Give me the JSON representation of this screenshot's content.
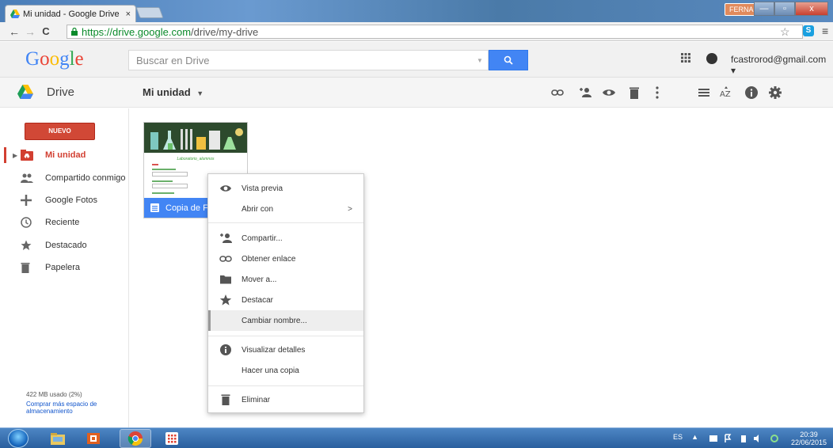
{
  "browser": {
    "tab_title": "Mi unidad - Google Drive",
    "tab_close": "×",
    "user_chip": "FERNANDO",
    "win_minimize": "—",
    "win_maximize": "▫",
    "win_close": "x",
    "url_host": "https://drive.google.com",
    "url_path": "/drive/my-drive",
    "nav_back": "←",
    "nav_forward": "→",
    "nav_reload": "C",
    "bookmark_star": "☆",
    "ext_label": "S",
    "menu": "≡"
  },
  "google": {
    "search_placeholder": "Buscar en Drive",
    "account": "fcastrorod@gmail.com ▾",
    "logo_colors": [
      "#4285f4",
      "#ea4335",
      "#fbbc05",
      "#4285f4",
      "#34a853",
      "#ea4335"
    ]
  },
  "drive": {
    "app_name": "Drive",
    "location": "Mi unidad",
    "location_caret": "▼"
  },
  "sidebar": {
    "new_label": "NUEVO",
    "items": [
      {
        "label": "Mi unidad",
        "icon": "my-drive-icon"
      },
      {
        "label": "Compartido conmigo",
        "icon": "shared-icon"
      },
      {
        "label": "Google Fotos",
        "icon": "photos-icon"
      },
      {
        "label": "Reciente",
        "icon": "clock-icon"
      },
      {
        "label": "Destacado",
        "icon": "star-icon"
      },
      {
        "label": "Papelera",
        "icon": "trash-icon"
      }
    ],
    "expand_arrow": "▶",
    "quota": "422 MB usado (2%)",
    "quota_link": "Comprar más espacio de almacenamiento"
  },
  "file": {
    "name": "Copia de Formulario",
    "thumb_title": "Laboratorio_alumnos"
  },
  "context_menu": {
    "items": [
      {
        "label": "Vista previa",
        "icon": "eye-icon"
      },
      {
        "label": "Abrir con",
        "icon": "",
        "submenu": ">"
      },
      {
        "label": "Compartir...",
        "icon": "share-icon"
      },
      {
        "label": "Obtener enlace",
        "icon": "link-icon"
      },
      {
        "label": "Mover a...",
        "icon": "folder-icon"
      },
      {
        "label": "Destacar",
        "icon": "star-icon"
      },
      {
        "label": "Cambiar nombre...",
        "icon": ""
      },
      {
        "label": "Visualizar detalles",
        "icon": "info-icon"
      },
      {
        "label": "Hacer una copia",
        "icon": ""
      },
      {
        "label": "Eliminar",
        "icon": "trash-icon"
      }
    ]
  },
  "taskbar": {
    "lang": "ES",
    "tray_arrow": "▲",
    "time": "20:39",
    "date": "22/06/2015"
  }
}
